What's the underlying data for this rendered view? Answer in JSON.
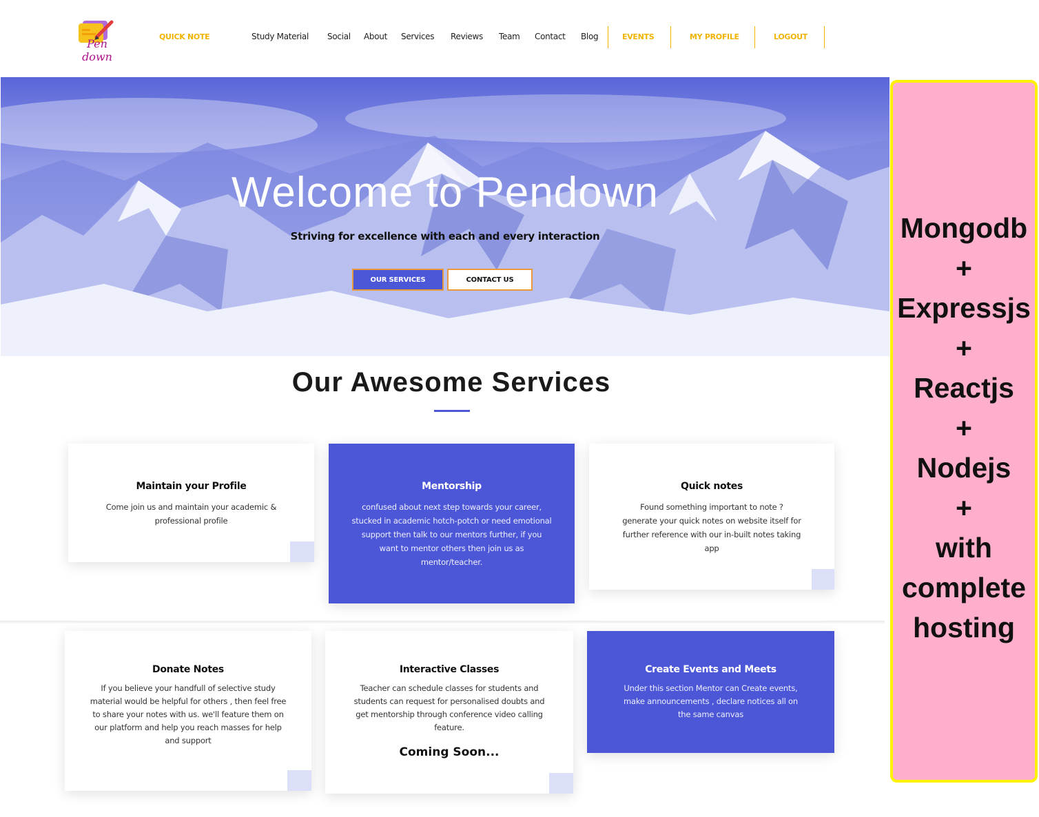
{
  "brand": {
    "logo_text": "Pen down",
    "icon": "pen-notes-logo-icon"
  },
  "nav": {
    "quick_note": "QUICK NOTE",
    "links": [
      "Study Material",
      "Social",
      "About",
      "Services",
      "Reviews",
      "Team",
      "Contact",
      "Blog"
    ],
    "events": "EVENTS",
    "my_profile": "MY PROFILE",
    "logout": "LOGOUT"
  },
  "hero": {
    "title": "Welcome to Pendown",
    "subtitle": "Striving for excellence with each and every interaction",
    "primary_button": "OUR SERVICES",
    "secondary_button": "CONTACT US"
  },
  "services": {
    "heading": "Our Awesome Services",
    "cards": [
      {
        "title": "Maintain your Profile",
        "text": "Come join us and maintain your academic & professional profile",
        "highlighted": false
      },
      {
        "title": "Mentorship",
        "text": "confused about next step towards your career, stucked in academic hotch-potch or need emotional support then talk to our mentors further, if you want to mentor others then join us as mentor/teacher.",
        "highlighted": true
      },
      {
        "title": "Quick notes",
        "text": "Found something important to note ? generate your quick notes on website itself for further reference with our in-built notes taking app",
        "highlighted": false
      },
      {
        "title": "Donate Notes",
        "text": "If you believe your handfull of selective study material would be helpful for others , then feel free to share your notes with us. we'll feature them on our platform and help you reach masses for help and support",
        "highlighted": false
      },
      {
        "title": "Interactive Classes",
        "text": "Teacher can schedule classes for students and students can request for personalised doubts and get mentorship through conference video calling feature.",
        "extra": "Coming Soon...",
        "highlighted": false
      },
      {
        "title": "Create Events and Meets",
        "text": "Under this section Mentor can Create events, make announcements , declare notices all on the same canvas",
        "highlighted": true
      }
    ]
  },
  "side_banner": {
    "lines": [
      "Mongodb",
      "+",
      "Expressjs",
      "+",
      "Reactjs",
      "+",
      "Nodejs",
      "+",
      "with",
      "complete",
      "hosting"
    ],
    "background": "#ffaecb",
    "border": "#fff200"
  },
  "colors": {
    "accent": "#4b57d6",
    "gold": "#f0b400",
    "button_border": "#e89a3a"
  }
}
